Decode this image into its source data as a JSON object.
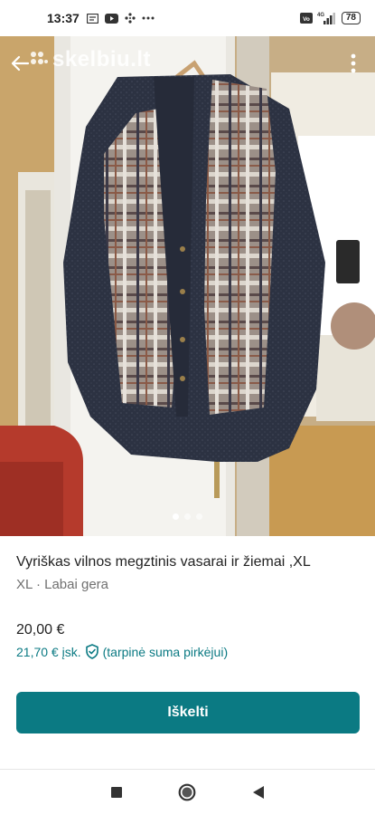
{
  "status_bar": {
    "time": "13:37",
    "battery": "78",
    "network_label": "4G",
    "icons_left": [
      "message-icon",
      "youtube-icon",
      "grid-icon",
      "more-dots-icon"
    ],
    "icons_right": [
      "volte-icon",
      "signal-icon",
      "battery-icon"
    ]
  },
  "photo": {
    "watermark": "skelbiu.lt",
    "page_count": 3,
    "current_page": 1
  },
  "listing": {
    "title": "Vyriškas vilnos megztinis  vasarai ir žiemai ,XL",
    "subtitle": "XL · Labai gera",
    "price": "20,00 €",
    "price_total": "21,70 € įsk.",
    "price_note": "(tarpinė suma pirkėjui)",
    "button_label": "Iškelti"
  },
  "colors": {
    "accent": "#0b7a83",
    "text": "#222222",
    "muted": "#707070"
  }
}
